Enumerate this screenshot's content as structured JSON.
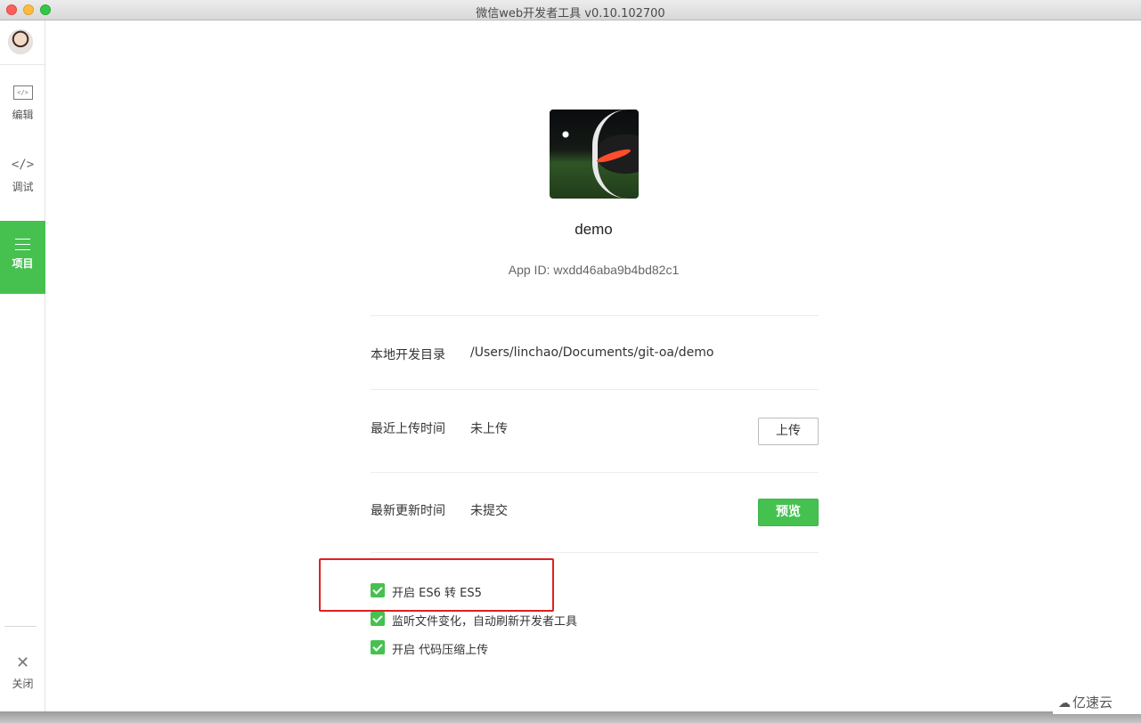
{
  "window": {
    "title": "微信web开发者工具 v0.10.102700"
  },
  "sidebar": {
    "items": [
      {
        "label": "编辑",
        "icon": "edit-icon"
      },
      {
        "label": "调试",
        "icon": "code-icon"
      },
      {
        "label": "项目",
        "icon": "menu-icon",
        "active": true
      }
    ],
    "close_label": "关闭"
  },
  "project": {
    "name": "demo",
    "app_id": "App ID: wxdd46aba9b4bd82c1",
    "rows": [
      {
        "label": "本地开发目录",
        "value": "/Users/linchao/Documents/git-oa/demo"
      },
      {
        "label": "最近上传时间",
        "value": "未上传",
        "button": "上传"
      },
      {
        "label": "最新更新时间",
        "value": "未提交",
        "button": "预览"
      }
    ],
    "options": [
      {
        "label": "开启 ES6 转 ES5",
        "checked": true
      },
      {
        "label": "监听文件变化，自动刷新开发者工具",
        "checked": true
      },
      {
        "label": "开启 代码压缩上传",
        "checked": true
      }
    ]
  },
  "watermark": {
    "text": "亿速云"
  },
  "colors": {
    "accent": "#46c150",
    "highlight": "#e02020"
  }
}
